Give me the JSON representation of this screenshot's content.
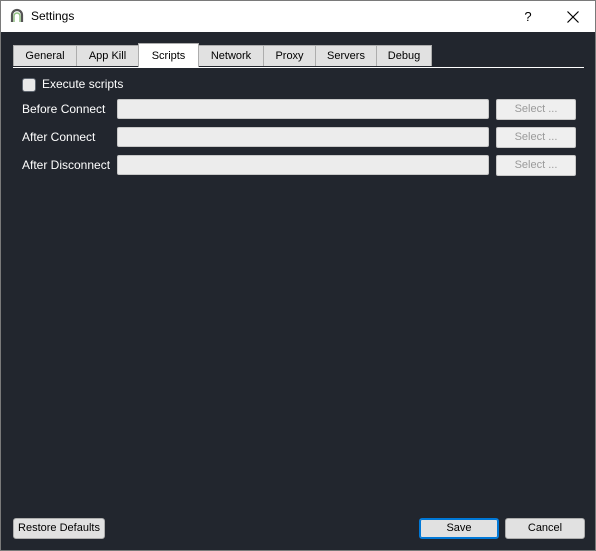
{
  "window": {
    "title": "Settings",
    "help_label": "?",
    "icons": {
      "app": "app-icon",
      "close": "close-icon"
    }
  },
  "tabs": [
    {
      "label": "General",
      "active": false
    },
    {
      "label": "App Kill",
      "active": false
    },
    {
      "label": "Scripts",
      "active": true
    },
    {
      "label": "Network",
      "active": false
    },
    {
      "label": "Proxy",
      "active": false
    },
    {
      "label": "Servers",
      "active": false
    },
    {
      "label": "Debug",
      "active": false
    }
  ],
  "scripts": {
    "execute_scripts_label": "Execute scripts",
    "execute_scripts_checked": false,
    "rows": [
      {
        "label": "Before Connect",
        "value": "",
        "button": "Select ..."
      },
      {
        "label": "After Connect",
        "value": "",
        "button": "Select ..."
      },
      {
        "label": "After Disconnect",
        "value": "",
        "button": "Select ..."
      }
    ]
  },
  "footer": {
    "restore_label": "Restore Defaults",
    "save_label": "Save",
    "cancel_label": "Cancel"
  },
  "colors": {
    "panel_background": "#22262e",
    "accent_focus": "#0078d7"
  }
}
